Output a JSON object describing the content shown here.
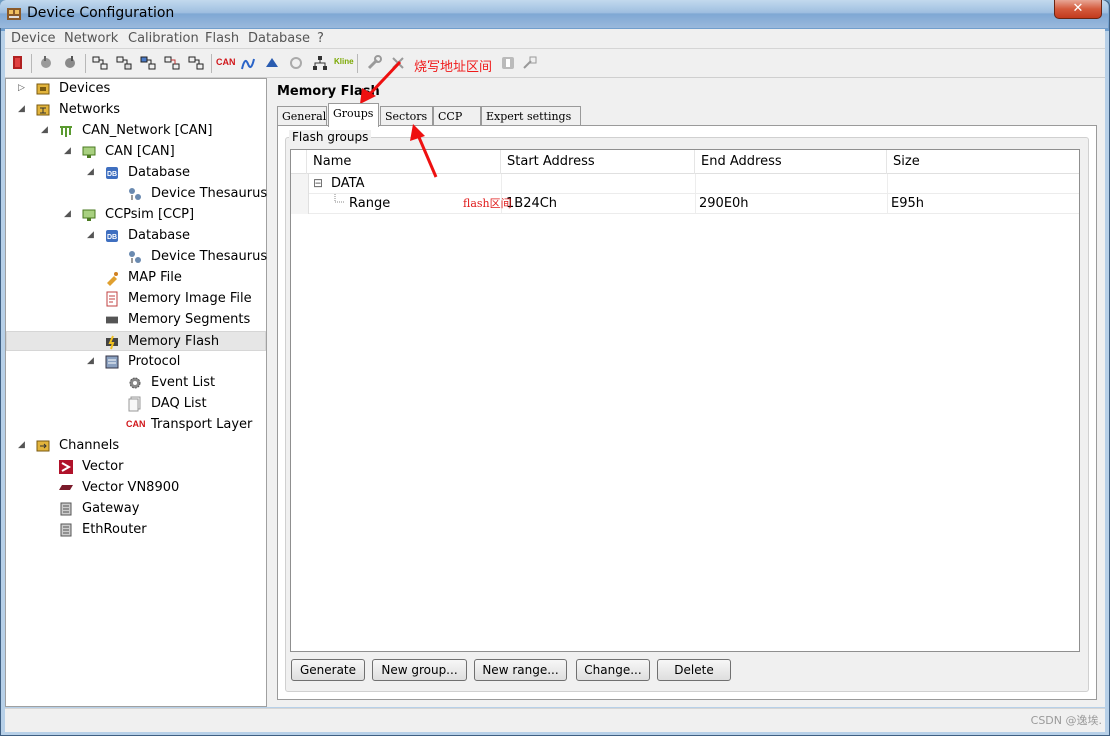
{
  "window": {
    "title": "Device Configuration",
    "close_glyph": "✕"
  },
  "menu": [
    "Device",
    "Network",
    "Calibration",
    "Flash",
    "Database",
    "?"
  ],
  "toolbar": {
    "can_label": "CAN",
    "kline_label": "Kline"
  },
  "annotations": {
    "toolbar_note": "烧写地址区间",
    "grid_note": "flash区间"
  },
  "tree": {
    "devices": "Devices",
    "networks": "Networks",
    "can_network": "CAN_Network [CAN]",
    "can": "CAN [CAN]",
    "database1": "Database",
    "thesaurus1": "Device Thesaurus",
    "ccpsim": "CCPsim [CCP]",
    "database2": "Database",
    "thesaurus2": "Device Thesaurus",
    "map_file": "MAP File",
    "memory_image": "Memory Image File",
    "memory_segments": "Memory Segments",
    "memory_flash": "Memory Flash",
    "protocol": "Protocol",
    "event_list": "Event List",
    "daq_list": "DAQ List",
    "transport_layer": "Transport Layer",
    "transport_can": "CAN",
    "channels": "Channels",
    "vector": "Vector",
    "vector_vn8900": "Vector VN8900",
    "gateway": "Gateway",
    "ethrouter": "EthRouter",
    "db_badge": "DB"
  },
  "panel": {
    "title": "Memory Flash",
    "tabs": [
      "General",
      "Groups",
      "Sectors",
      "CCP",
      "Expert settings"
    ],
    "active_tab": "Groups",
    "group_label": "Flash groups"
  },
  "grid": {
    "headers": [
      "Name",
      "Start Address",
      "End Address",
      "Size"
    ],
    "expander": "⊟",
    "rows": [
      {
        "name": "DATA",
        "start": "",
        "end": "",
        "size": ""
      },
      {
        "name": "Range",
        "start": "1B24Ch",
        "end": "290E0h",
        "size": "E95h"
      }
    ]
  },
  "buttons": [
    "Generate",
    "New group...",
    "New range...",
    "Change...",
    "Delete"
  ],
  "watermark": "CSDN @逸埃."
}
